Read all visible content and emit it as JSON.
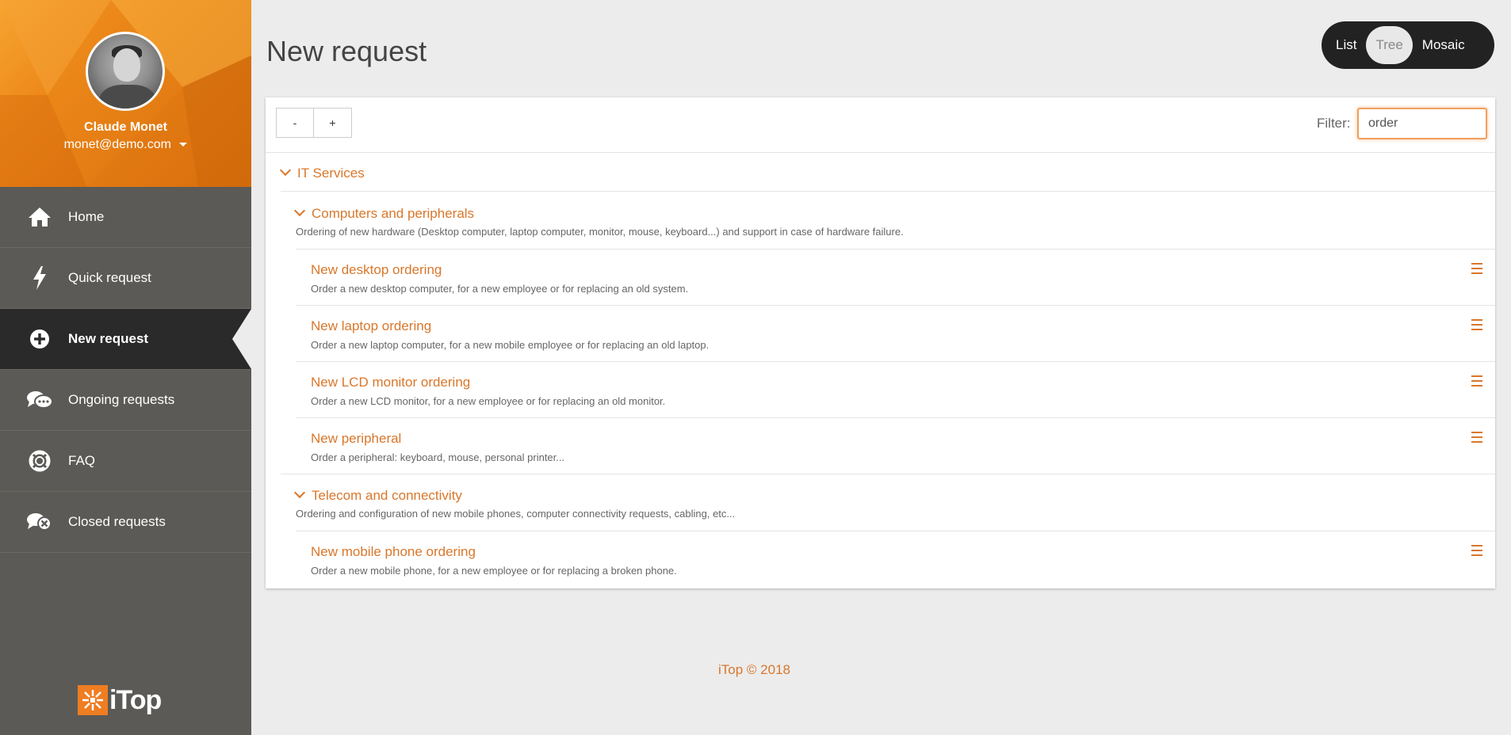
{
  "user": {
    "name": "Claude Monet",
    "email": "monet@demo.com"
  },
  "menu": [
    {
      "label": "Home",
      "icon": "home-icon"
    },
    {
      "label": "Quick request",
      "icon": "lightning-icon"
    },
    {
      "label": "New request",
      "icon": "plus-circle-icon",
      "active": true
    },
    {
      "label": "Ongoing requests",
      "icon": "chat-bubbles-icon"
    },
    {
      "label": "FAQ",
      "icon": "lifebuoy-icon"
    },
    {
      "label": "Closed requests",
      "icon": "chat-closed-icon"
    }
  ],
  "logo": {
    "text": "iTop"
  },
  "page": {
    "title": "New request"
  },
  "view_toggle": {
    "list": "List",
    "tree": "Tree",
    "mosaic": "Mosaic",
    "selected": "Tree"
  },
  "toolbar": {
    "collapse": "-",
    "expand": "+"
  },
  "filter": {
    "label": "Filter:",
    "value": "order"
  },
  "tree": {
    "category": "IT Services",
    "groups": [
      {
        "title": "Computers and peripherals",
        "description": "Ordering of new hardware (Desktop computer, laptop computer, monitor, mouse, keyboard...) and support in case of hardware failure.",
        "services": [
          {
            "title": "New desktop ordering",
            "description": "Order a new desktop computer, for a new employee or for replacing an old system."
          },
          {
            "title": "New laptop ordering",
            "description": "Order a new laptop computer, for a new mobile employee or for replacing an old laptop."
          },
          {
            "title": "New LCD monitor ordering",
            "description": "Order a new LCD monitor, for a new employee or for replacing an old monitor."
          },
          {
            "title": "New peripheral",
            "description": "Order a peripheral: keyboard, mouse, personal printer..."
          }
        ]
      },
      {
        "title": "Telecom and connectivity",
        "description": "Ordering and configuration of new mobile phones, computer connectivity requests, cabling, etc...",
        "services": [
          {
            "title": "New mobile phone ordering",
            "description": "Order a new mobile phone, for a new employee or for replacing a broken phone."
          }
        ]
      }
    ]
  },
  "footer": {
    "text": "iTop © 2018"
  },
  "colors": {
    "accent": "#d9772b",
    "sidebar": "#5b5a56",
    "active_item": "#2a2a2a",
    "background": "#ececec"
  }
}
